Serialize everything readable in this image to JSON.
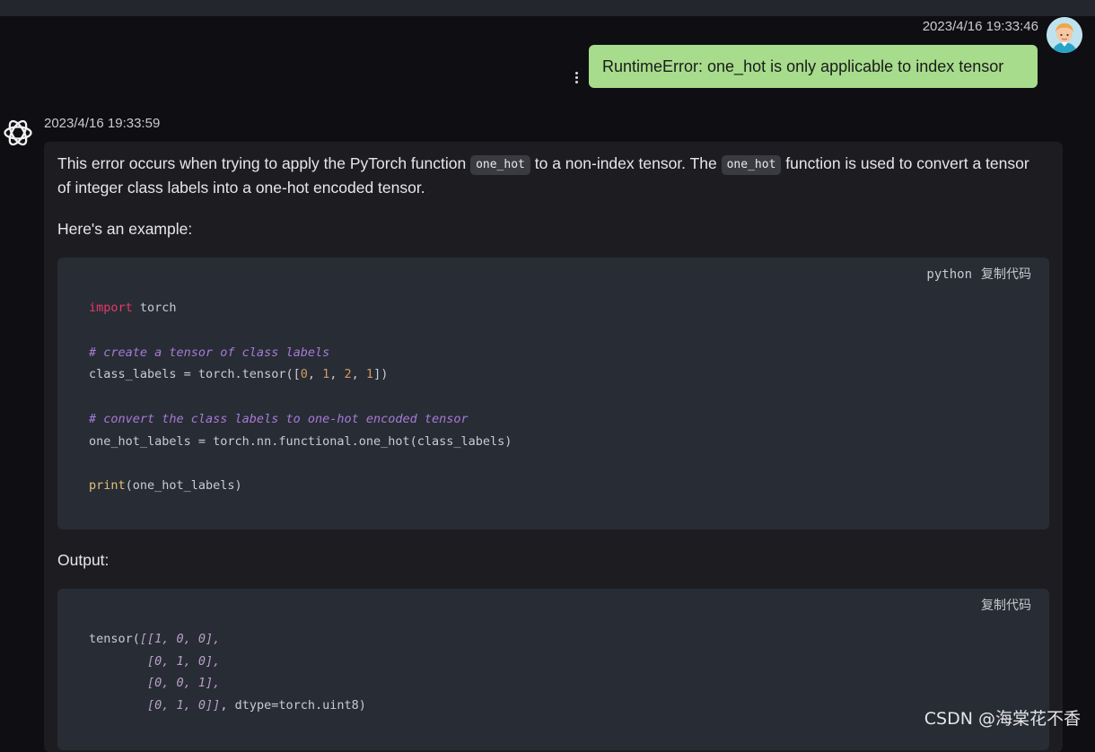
{
  "user_message": {
    "timestamp": "2023/4/16 19:33:46",
    "text": "RuntimeError: one_hot is only applicable to index tensor"
  },
  "assistant_message": {
    "timestamp": "2023/4/16 19:33:59",
    "intro_part1": "This error occurs when trying to apply the PyTorch function ",
    "intro_code1": "one_hot",
    "intro_part2": " to a non-index tensor. The ",
    "intro_code2": "one_hot",
    "intro_part3": " function is used to convert a tensor",
    "intro_line2": "of integer class labels into a one-hot encoded tensor.",
    "example_label": "Here's an example:",
    "output_label": "Output:"
  },
  "code_block_1": {
    "language": "python",
    "copy_label": "复制代码",
    "line1_kw": "import",
    "line1_rest": " torch",
    "line2_comment": "# create a tensor of class labels",
    "line3_a": "class_labels = torch.tensor([",
    "line3_n1": "0",
    "line3_n2": "1",
    "line3_n3": "2",
    "line3_n4": "1",
    "line3_end": "])",
    "line4_comment": "# convert the class labels to one-hot encoded tensor",
    "line5": "one_hot_labels = torch.nn.functional.one_hot(class_labels)",
    "line6_fn": "print",
    "line6_rest": "(one_hot_labels)"
  },
  "code_block_2": {
    "copy_label": "复制代码",
    "line1_a": "tensor(",
    "line1_b": "[[1, 0, 0],",
    "line2": "        [0, 1, 0],",
    "line3": "        [0, 0, 1],",
    "line4_a": "        [0, 1, 0]]",
    "line4_b": ", dtype=torch.uint8)"
  },
  "watermark": "CSDN @海棠花不香",
  "icons": {
    "assistant_logo": "openai-logo-icon",
    "more": "more-vertical-icon",
    "avatar": "user-avatar"
  }
}
